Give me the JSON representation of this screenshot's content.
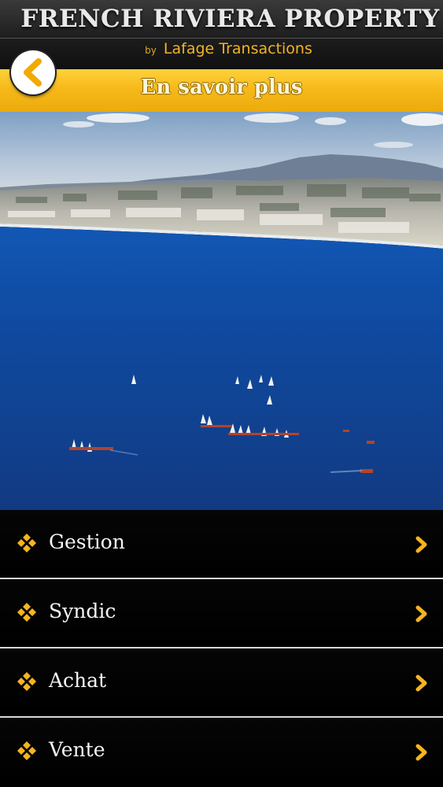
{
  "header": {
    "brand_title": "FRENCH RIVIERA PROPERTY",
    "by": "by",
    "company": "Lafage Transactions"
  },
  "title_bar": {
    "title": "En savoir plus",
    "back_icon": "chevron-left-icon"
  },
  "hero": {
    "icon": "coastline-photo"
  },
  "menu": {
    "items": [
      {
        "label": "Gestion",
        "bullet_icon": "diamond-cluster-icon",
        "chevron_icon": "chevron-right-icon"
      },
      {
        "label": "Syndic",
        "bullet_icon": "diamond-cluster-icon",
        "chevron_icon": "chevron-right-icon"
      },
      {
        "label": "Achat",
        "bullet_icon": "diamond-cluster-icon",
        "chevron_icon": "chevron-right-icon"
      },
      {
        "label": "Vente",
        "bullet_icon": "diamond-cluster-icon",
        "chevron_icon": "chevron-right-icon"
      }
    ]
  },
  "colors": {
    "accent": "#f6b919",
    "menu_background": "#000000",
    "divider": "#d8d8d8"
  }
}
